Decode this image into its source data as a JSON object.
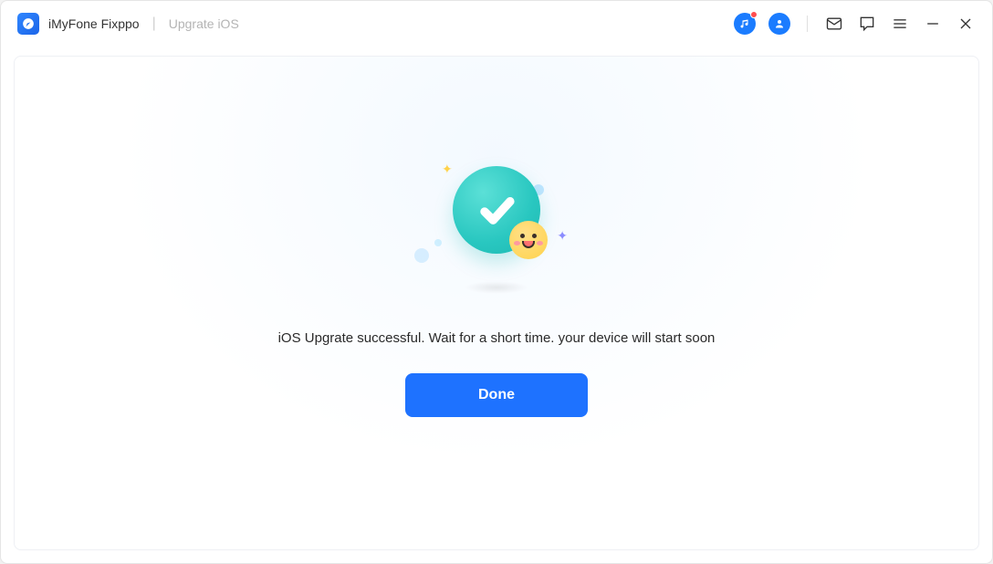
{
  "titlebar": {
    "app_name": "iMyFone Fixppo",
    "subtitle": "Upgrate iOS"
  },
  "main": {
    "status_message": "iOS Upgrate successful. Wait for a short time. your device will start soon",
    "done_label": "Done"
  },
  "icons": {
    "music": "music-icon",
    "account": "account-icon",
    "mail": "mail-icon",
    "feedback": "feedback-icon",
    "menu": "menu-icon",
    "minimize": "minimize-icon",
    "close": "close-icon"
  }
}
